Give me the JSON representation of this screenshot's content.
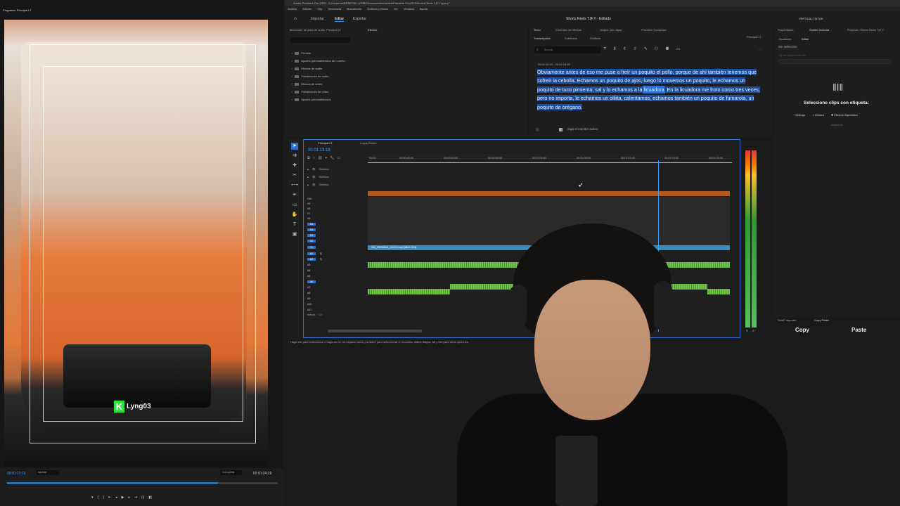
{
  "window": {
    "title": "Adobe Premiere Pro 2023 - C:\\Usuarios\\DESKTOP-1G5B2\\Documentos\\Adobe\\Premiere Pro\\23.0\\Shorts Reels TJF.Y.prproj *"
  },
  "menu": [
    "Archivo",
    "Edición",
    "Clip",
    "Secuencia",
    "Marcadores",
    "Gráficos y títulos",
    "Ver",
    "Ventana",
    "Ayuda"
  ],
  "appbar": {
    "modes": [
      "Importar",
      "Editar",
      "Exportar"
    ],
    "title": "Shorts Reels TJF,Y - Editado",
    "workspace": "VERTICAL TIKTOK"
  },
  "monitor": {
    "tab": "Programa: Principal LT",
    "timecode": "00:01:13:19",
    "fit": "Ajustar",
    "resolution": "Completa",
    "duration": "00:01:24:19",
    "watermark": "Lyng03"
  },
  "effects": {
    "tabs": [
      "Mezclador de pista de audio: Principal LT",
      "Efectos"
    ],
    "items": [
      "Presets",
      "Ajustes preestablecidos de Lumetri",
      "Efectos de audio",
      "Transiciones de audio",
      "Efectos de vídeo",
      "Transiciones de vídeo",
      "Ajustes preestablecidos"
    ]
  },
  "transcript": {
    "tabs": [
      "Texto",
      "Controles de efectos",
      "Origen: (sin clips)",
      "Premiere Composer"
    ],
    "subtabs": [
      "Transcripción",
      "Subtítulos",
      "Gráficos"
    ],
    "sequence": "Principal LT",
    "search_placeholder": "Buscar",
    "time": "00:01:02:43 - 00:01:18:50",
    "text_before": "Obviamente antes de eso me puse a freír un poquito el pollo, porque de ahí también tenemos que sofreír la cebolla. Echamos un poquito de ajos, luego lo movemos un poquito, le echamos un poquito de tuco pimienta, sal y lo echamos a la ",
    "text_highlight": "licuadora",
    "text_after": ". En la licuadora me froto como tres veces, pero no importa, le echamos un olliita, calentamos, echamos también un poquito de fumarola, un poquito de orégano.",
    "footer": "Siga el monitor activo"
  },
  "essential_sound": {
    "tabs": [
      "Propiedades",
      "Sonido esencial",
      "Proyecto: Shorts Reels TJF,Y"
    ],
    "subtabs": [
      "Examinar",
      "Editor"
    ],
    "status": "Sin selección",
    "preset": "Ajuste preestablecido",
    "label": "Seleccione clips con etiqueta:",
    "options": [
      "Diálogo",
      "Música",
      "Efectos especiales"
    ],
    "ambient": "Ambiente"
  },
  "copy_paste": {
    "tabs": [
      "DowP Importer",
      "Copy Paste"
    ],
    "copy": "Copy",
    "paste": "Paste"
  },
  "timeline": {
    "tabs": [
      "Principal LT",
      "Logos Redes"
    ],
    "timecode": "00:01:13:18",
    "ruler": [
      "00:00",
      "00:00:45:00",
      "00:00:50:00",
      "00:00:55:00",
      "00:01:00:00",
      "00:01:05:00",
      "00:01:10:00",
      "00:01:15:00",
      "00:01:20:00"
    ],
    "subtitle_tracks": [
      "Subtítulo",
      "Subtítulo",
      "Subtítulo"
    ],
    "video_tracks": [
      "V10",
      "V9",
      "V8",
      "V7",
      "V6",
      "V5",
      "V4",
      "V3",
      "V2",
      "V1"
    ],
    "audio_tracks": [
      "A1",
      "A2",
      "A3",
      "A4",
      "A5",
      "A6",
      "A7",
      "A8",
      "A9",
      "A10",
      "A11"
    ],
    "mix": "Mezcla",
    "mix_val": "0.0",
    "clip_name": "VID_20230816_131012.mp4 [88.8.76%]",
    "status": "Haga clic para seleccionar o haga clic en un espacio vacío y arrastre para seleccionar el recuadro. Utilice Mayús, Alt y Ctrl para otras opciones."
  },
  "meter": {
    "labels": [
      "S",
      "S"
    ]
  }
}
